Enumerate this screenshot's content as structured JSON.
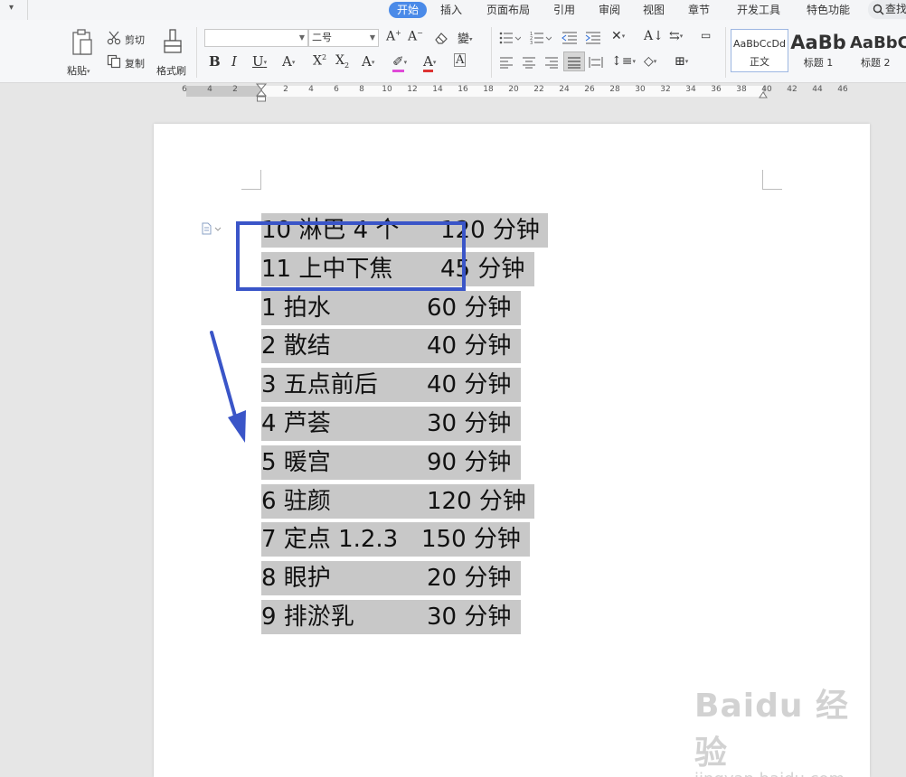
{
  "menu": {
    "tabs": [
      "开始",
      "插入",
      "页面布局",
      "引用",
      "审阅",
      "视图",
      "章节",
      "开发工具",
      "特色功能"
    ],
    "active_tab": "开始",
    "search_label": "查找"
  },
  "ribbon": {
    "paste_label": "粘贴",
    "cut_label": "剪切",
    "copy_label": "复制",
    "format_painter_label": "格式刷",
    "font_name_value": "",
    "font_size_value": "二号",
    "styles": [
      {
        "sample": "AaBbCcDd",
        "name": "正文"
      },
      {
        "sample": "AaBb",
        "name": "标题 1"
      },
      {
        "sample": "AaBbC",
        "name": "标题 2"
      }
    ]
  },
  "ruler": {
    "ticks": [
      "6",
      "4",
      "2",
      "",
      "2",
      "4",
      "6",
      "8",
      "10",
      "12",
      "14",
      "16",
      "18",
      "20",
      "22",
      "24",
      "26",
      "28",
      "30",
      "32",
      "34",
      "36",
      "38",
      "40",
      "42",
      "44",
      "46"
    ]
  },
  "document": {
    "lines": [
      {
        "name": "10 淋巴 4 个",
        "duration": "120 分钟"
      },
      {
        "name": "11 上中下焦",
        "duration": "45 分钟"
      },
      {
        "name": "1 拍水",
        "duration": "60 分钟"
      },
      {
        "name": "2 散结",
        "duration": "40 分钟"
      },
      {
        "name": "3 五点前后",
        "duration": "40 分钟"
      },
      {
        "name": "4 芦荟",
        "duration": "30 分钟"
      },
      {
        "name": "5 暖宫",
        "duration": "90 分钟"
      },
      {
        "name": "6 驻颜",
        "duration": "120 分钟"
      },
      {
        "name": "7 定点 1.2.3",
        "duration": "150 分钟"
      },
      {
        "name": "8 眼护",
        "duration": "20 分钟"
      },
      {
        "name": "9 排淤乳",
        "duration": "30 分钟"
      }
    ]
  },
  "watermark": {
    "main": "Baidu 经验",
    "url": "jingyan.baidu.com"
  },
  "colors": {
    "active_tab": "#4a8ae8",
    "selection": "#c8c8c8",
    "annotation": "#3a55c8"
  }
}
